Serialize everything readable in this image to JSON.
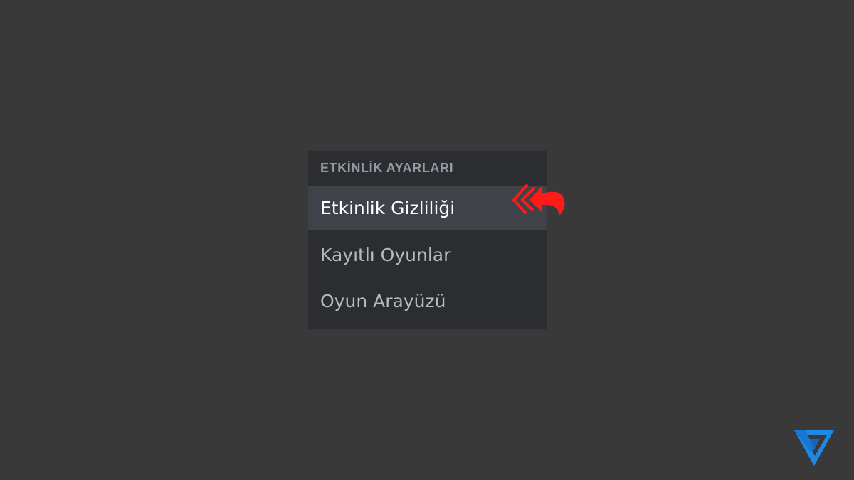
{
  "menu": {
    "section_header": "ETKİNLİK AYARLARI",
    "items": [
      {
        "label": "Etkinlik Gizliliği",
        "selected": true
      },
      {
        "label": "Kayıtlı Oyunlar",
        "selected": false
      },
      {
        "label": "Oyun Arayüzü",
        "selected": false
      }
    ]
  },
  "annotation": {
    "icon": "red-curved-arrow-icon",
    "color": "#ff1a1a"
  },
  "logo": {
    "icon": "blue-triangle-logo",
    "color": "#1e88e5"
  },
  "colors": {
    "background": "#393939",
    "panel": "#2b2d31",
    "selected_row": "#404249",
    "header_text": "#949ba4",
    "item_text": "#b5bac1",
    "selected_text": "#ffffff"
  }
}
